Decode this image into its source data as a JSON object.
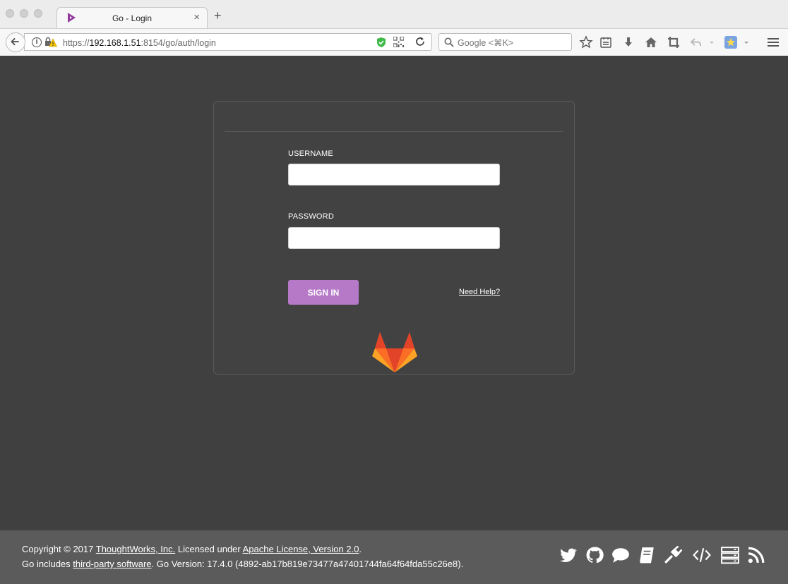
{
  "browser": {
    "tab_title": "Go - Login",
    "tab_close": "×",
    "new_tab": "+",
    "url_prefix": "https://",
    "url_host": "192.168.1.51",
    "url_rest": ":8154/go/auth/login",
    "search_placeholder": "Google <⌘K>",
    "info_glyph": "i"
  },
  "login": {
    "username_label": "USERNAME",
    "password_label": "PASSWORD",
    "username_value": "",
    "password_value": "",
    "signin_label": "SIGN IN",
    "help_label": "Need Help?"
  },
  "footer": {
    "copyright_prefix": "Copyright © 2017 ",
    "thoughtworks_link": "ThoughtWorks, Inc.",
    "licensed_under": " Licensed under ",
    "license_link": "Apache License, Version 2.0",
    "period": ".",
    "includes_prefix": "Go includes ",
    "third_party_link": "third-party software",
    "version_text": ". Go Version: 17.4.0 (4892-ab17b819e73477a47401744fa64f64fda55c26e8).",
    "social_icons": [
      "twitter-icon",
      "github-icon",
      "chat-icon",
      "docs-icon",
      "plugin-icon",
      "api-icon",
      "server-icon",
      "rss-icon"
    ]
  },
  "colors": {
    "page_bg": "#404040",
    "footer_bg": "#5b5b5b",
    "button_purple": "#b679c8",
    "fox_orange": "#fc6d26",
    "fox_red": "#e24329",
    "fox_yellow": "#fca326"
  }
}
